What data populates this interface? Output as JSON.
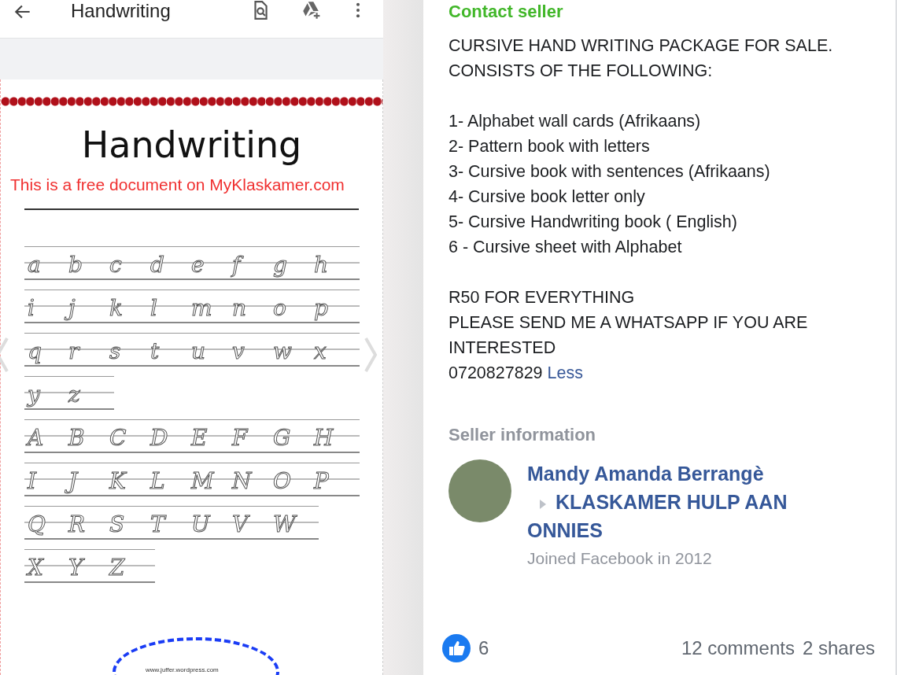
{
  "viewer": {
    "title": "Handwriting"
  },
  "document": {
    "heading": "Handwriting",
    "notice": "This is a free document on MyKlaskamer.com",
    "footer": "www.juffer.wordpress.com",
    "letter_rows": [
      [
        "a",
        "b",
        "c",
        "d",
        "e",
        "f",
        "g",
        "h"
      ],
      [
        "i",
        "j",
        "k",
        "l",
        "m",
        "n",
        "o",
        "p"
      ],
      [
        "q",
        "r",
        "s",
        "t",
        "u",
        "v",
        "w",
        "x"
      ],
      [
        "y",
        "z"
      ],
      [
        "A",
        "B",
        "C",
        "D",
        "E",
        "F",
        "G",
        "H"
      ],
      [
        "I",
        "J",
        "K",
        "L",
        "M",
        "N",
        "O",
        "P"
      ],
      [
        "Q",
        "R",
        "S",
        "T",
        "U",
        "V",
        "W"
      ],
      [
        "X",
        "Y",
        "Z"
      ]
    ]
  },
  "listing": {
    "contact_heading": "Contact seller",
    "description": [
      [
        "CURSIVE HAND WRITING PACKAGE FOR SALE.",
        "CONSISTS OF THE FOLLOWING:"
      ],
      [
        "1- Alphabet wall cards (Afrikaans)",
        "2- Pattern book with letters",
        "3- Cursive book with sentences (Afrikaans)",
        "4- Cursive book letter only",
        "5- Cursive Handwriting book ( English)",
        "6 - Cursive sheet with Alphabet"
      ],
      [
        "R50 FOR EVERYTHING",
        "PLEASE SEND ME A WHATSAPP IF YOU ARE",
        "INTERESTED"
      ]
    ],
    "phone": "0720827829",
    "less_link": "Less",
    "seller_heading": "Seller information",
    "seller_name": "Mandy Amanda Berrangè",
    "group_name": "KLASKAMER HULP AAN ONNIES",
    "joined": "Joined Facebook in 2012",
    "likes": "6",
    "comments": "12 comments",
    "shares": "2 shares"
  }
}
